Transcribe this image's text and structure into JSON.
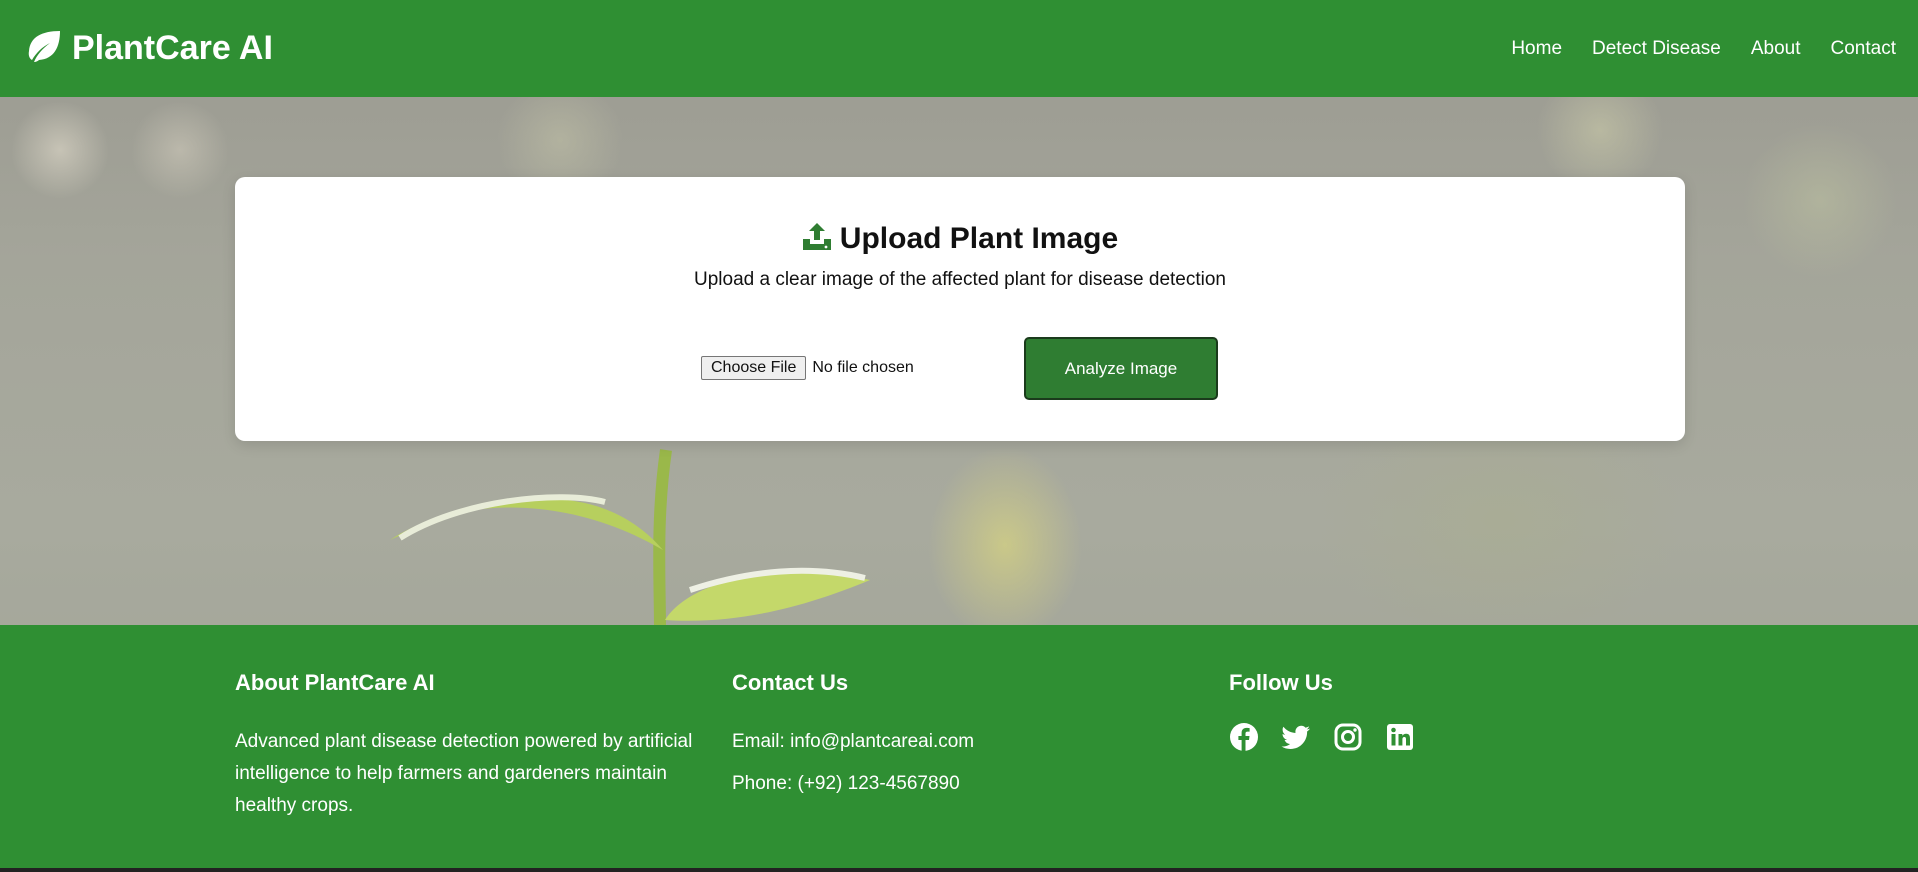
{
  "header": {
    "brand": "PlantCare AI",
    "brand_icon": "leaf-icon",
    "nav": [
      {
        "label": "Home"
      },
      {
        "label": "Detect Disease"
      },
      {
        "label": "About"
      },
      {
        "label": "Contact"
      }
    ]
  },
  "upload": {
    "icon": "upload-icon",
    "title": "Upload Plant Image",
    "subtitle": "Upload a clear image of the affected plant for disease detection",
    "choose_file_label": "Choose File",
    "file_status": "No file chosen",
    "analyze_label": "Analyze Image"
  },
  "footer": {
    "about": {
      "heading": "About PlantCare AI",
      "text": "Advanced plant disease detection powered by artificial intelligence to help farmers and gardeners maintain healthy crops."
    },
    "contact": {
      "heading": "Contact Us",
      "email": "Email: info@plantcareai.com",
      "phone": "Phone: (+92) 123-4567890"
    },
    "follow": {
      "heading": "Follow Us",
      "icons": [
        "facebook-icon",
        "twitter-icon",
        "instagram-icon",
        "linkedin-icon"
      ]
    }
  },
  "colors": {
    "primary_green": "#2f8f33",
    "button_green": "#2f7d32"
  }
}
